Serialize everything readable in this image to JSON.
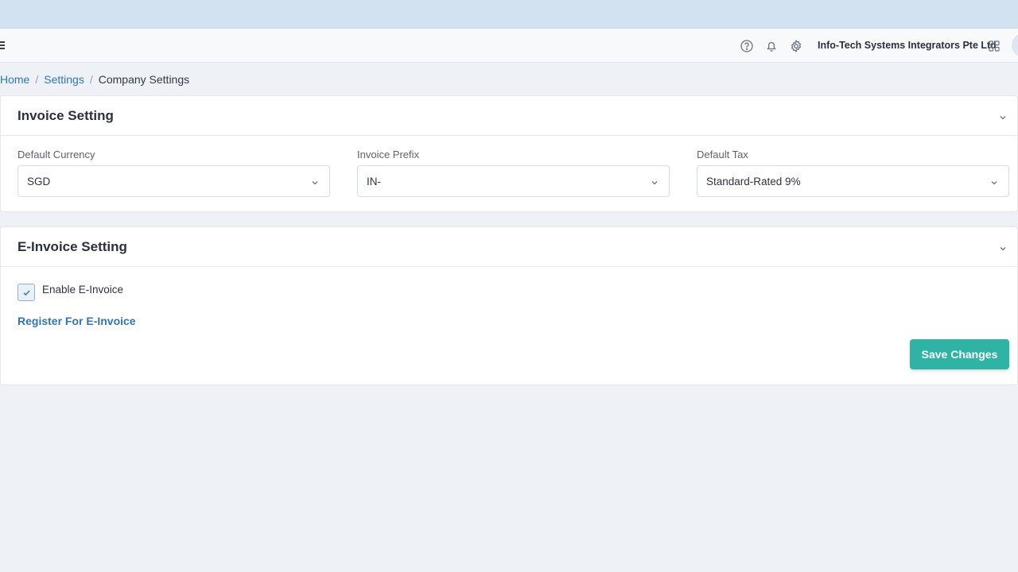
{
  "header": {
    "company_name": "Info-Tech Systems Integrators Pte Ltd",
    "icons": [
      "menu-icon",
      "help-icon",
      "bell-icon",
      "gear-icon",
      "apps-grid-icon"
    ]
  },
  "breadcrumb": {
    "home": "Home",
    "settings": "Settings",
    "current": "Company Settings",
    "separator": "/"
  },
  "invoice_setting": {
    "title": "Invoice Setting",
    "default_currency": {
      "label": "Default Currency",
      "value": "SGD"
    },
    "invoice_prefix": {
      "label": "Invoice Prefix",
      "value": "IN-"
    },
    "default_tax": {
      "label": "Default Tax",
      "value": "Standard-Rated 9%"
    }
  },
  "einvoice_setting": {
    "title": "E-Invoice Setting",
    "enable_label": "Enable E-Invoice",
    "enabled": true,
    "register_link": "Register For E-Invoice",
    "save_label": "Save Changes"
  },
  "colors": {
    "accent_link": "#3275b8",
    "save_button": "#2eb3a4",
    "top_strip": "#d3e2f1"
  }
}
